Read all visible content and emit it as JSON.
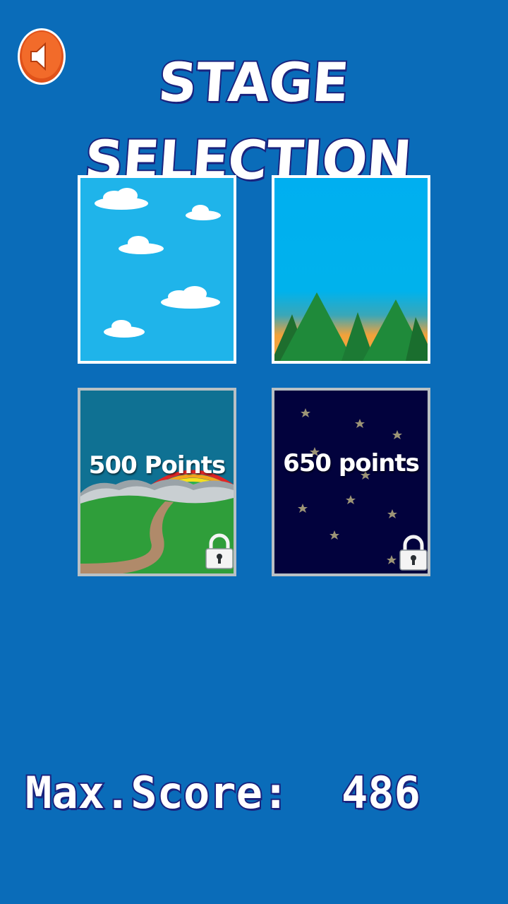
{
  "header": {
    "title": "STAGE SELECTION",
    "sound_icon": "speaker-icon"
  },
  "stages": [
    {
      "theme": "sky-clouds",
      "locked": false
    },
    {
      "theme": "mountains",
      "locked": false
    },
    {
      "theme": "rainbow-road",
      "locked": true,
      "unlock_label": "500 Points",
      "lock_icon": "padlock-icon"
    },
    {
      "theme": "night-stars",
      "locked": true,
      "unlock_label": "650 points",
      "lock_icon": "padlock-icon"
    }
  ],
  "footer": {
    "max_score_label": "Max.Score:",
    "max_score_value": "486"
  },
  "colors": {
    "background": "#0a6cb9",
    "sound_button": "#f05a16",
    "title_outline": "#1a237e"
  }
}
